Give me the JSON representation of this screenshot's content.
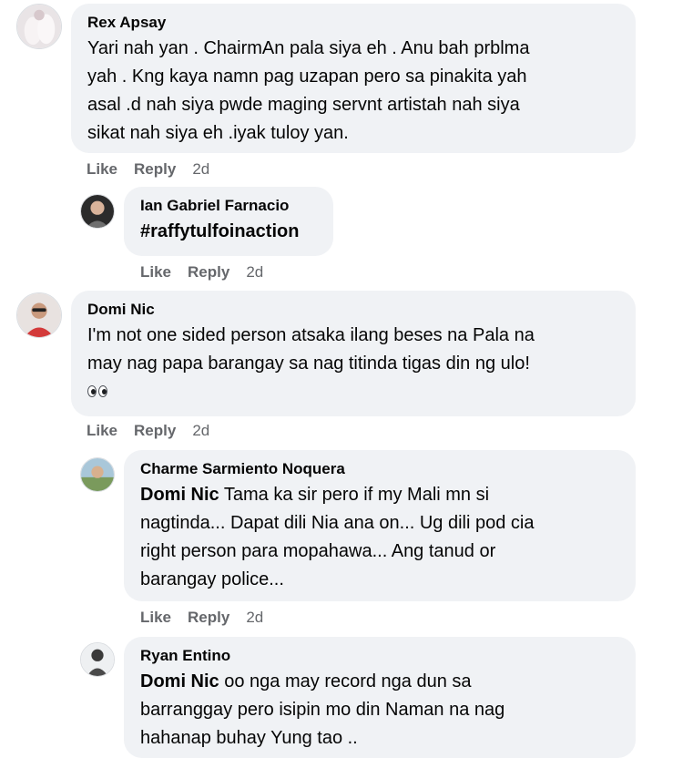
{
  "comments": [
    {
      "author": "Rex Apsay",
      "lines": [
        "Yari nah yan . ChairmAn pala siya eh . Anu bah prblma",
        "yah . Kng kaya namn pag uzapan pero sa pinakita yah",
        "asal .d nah siya pwde maging servnt artistah nah siya",
        "sikat nah siya eh .iyak tuloy yan."
      ],
      "like": "Like",
      "reply": "Reply",
      "time": "2d"
    },
    {
      "author": "Ian Gabriel Farnacio",
      "hashtag": "#raffytulfoinaction",
      "like": "Like",
      "reply": "Reply",
      "time": "2d"
    },
    {
      "author": "Domi Nic",
      "lines": [
        "I'm not one sided person atsaka ilang beses na Pala na",
        "may nag papa barangay sa nag titinda tigas din ng ulo!"
      ],
      "emoji": "eyes",
      "like": "Like",
      "reply": "Reply",
      "time": "2d"
    },
    {
      "author": "Charme Sarmiento Noquera",
      "mention": "Domi Nic",
      "first_line_rest": " Tama ka sir pero if my Mali mn si",
      "lines": [
        "nagtinda... Dapat dili Nia ana on... Ug dili pod cia",
        "right person para mopahawa... Ang tanud or",
        "barangay police..."
      ],
      "like": "Like",
      "reply": "Reply",
      "time": "2d"
    },
    {
      "author": "Ryan Entino",
      "mention": "Domi Nic",
      "first_line_rest": " oo nga may record nga dun sa",
      "lines": [
        "barranggay pero isipin mo din Naman na nag",
        "hahanap buhay Yung tao .."
      ]
    }
  ]
}
